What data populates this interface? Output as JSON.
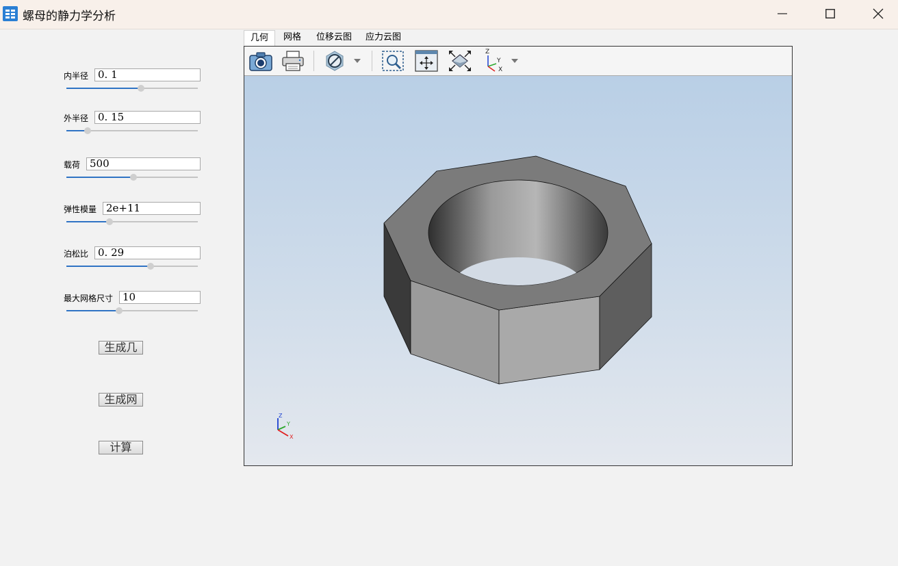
{
  "window": {
    "title": "螺母的静力学分析",
    "icon": "app-icon",
    "controls": [
      "minimize-icon",
      "maximize-icon",
      "close-icon"
    ]
  },
  "params": {
    "inner_radius": {
      "label": "内半径",
      "value": "0. 1",
      "slider_fraction": 0.57
    },
    "outer_radius": {
      "label": "外半径",
      "value": "0. 15",
      "slider_fraction": 0.16
    },
    "load": {
      "label": "载荷",
      "value": "500",
      "slider_fraction": 0.51
    },
    "elastic_modulus": {
      "label": "弹性模量",
      "value": "2e+11",
      "slider_fraction": 0.33
    },
    "poisson_ratio": {
      "label": "泊松比",
      "value": "0. 29",
      "slider_fraction": 0.64
    },
    "max_mesh_size": {
      "label": "最大网格尺寸",
      "value": "10",
      "slider_fraction": 0.4
    }
  },
  "actions": {
    "generate_geometry": "生成几何",
    "generate_mesh": "生成网格",
    "compute": "计算"
  },
  "tabs": [
    "几何",
    "网格",
    "位移云图",
    "应力云图"
  ],
  "active_tab": "几何",
  "toolbar_icons": [
    "camera-icon",
    "printer-icon",
    "display-mode-icon",
    "dropdown-arrow-icon",
    "zoom-box-icon",
    "pan-icon",
    "fit-all-icon",
    "view-axes-icon",
    "dropdown-arrow-icon"
  ],
  "axis_labels": {
    "x": "X",
    "y": "Y",
    "z": "Z"
  },
  "colors": {
    "accent": "#2f73c4",
    "axis_x": "#e02020",
    "axis_y": "#2ea82e",
    "axis_z": "#1a3fd0"
  }
}
